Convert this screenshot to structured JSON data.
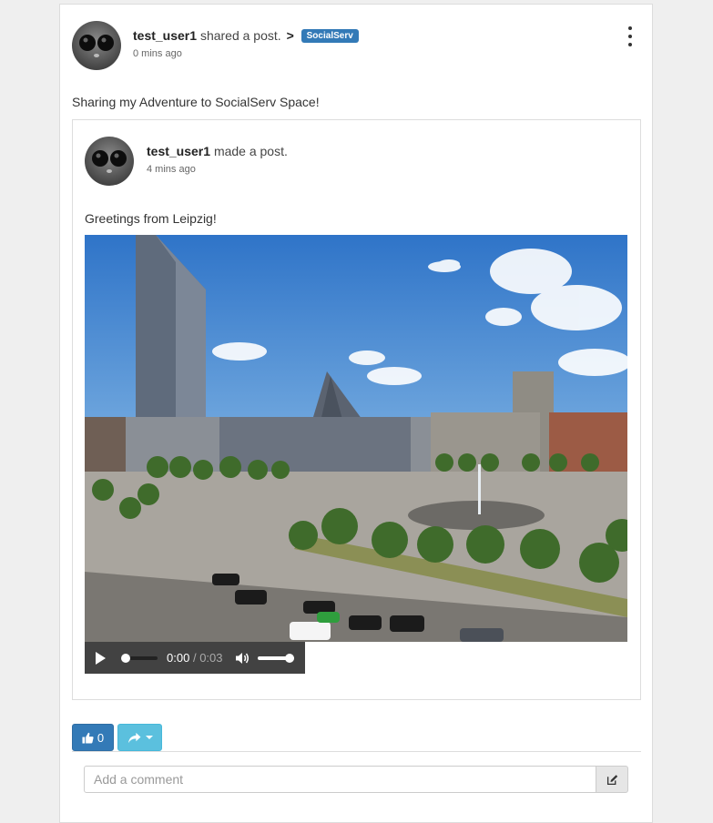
{
  "post": {
    "author": "test_user1",
    "action": "shared a post.",
    "arrow": ">",
    "group_badge": "SocialServ",
    "time": "0 mins ago",
    "text": "Sharing my Adventure to SocialServ Space!"
  },
  "shared_post": {
    "author": "test_user1",
    "action": "made a post.",
    "time": "4 mins ago",
    "text": "Greetings from Leipzig!"
  },
  "player": {
    "current": "0:00",
    "separator": "/",
    "duration": "0:03",
    "progress": 0,
    "volume": 1.0
  },
  "actions": {
    "like_count": "0"
  },
  "comment": {
    "placeholder": "Add a comment"
  },
  "colors": {
    "primary": "#337ab7",
    "info": "#5bc0de",
    "player_bg": "#424242"
  },
  "icons": {
    "like": "thumbs-up-icon",
    "share": "share-icon",
    "menu": "kebab-icon",
    "play": "play-icon",
    "volume": "volume-icon",
    "edit": "edit-icon"
  }
}
